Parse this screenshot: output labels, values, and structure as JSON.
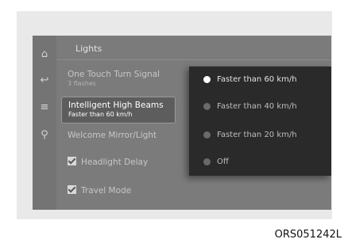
{
  "screen": {
    "title": "Lights"
  },
  "nav": [
    {
      "icon": "home-icon",
      "glyph": "⌂"
    },
    {
      "icon": "back-icon",
      "glyph": "↩"
    },
    {
      "icon": "menu-icon",
      "glyph": "≡"
    },
    {
      "icon": "search-icon",
      "glyph": "⚲"
    }
  ],
  "settings": {
    "one_touch": {
      "label": "One Touch Turn Signal",
      "value": "3 flashes"
    },
    "intelligent": {
      "label": "Intelligent High Beams",
      "value": "Faster than 60 km/h"
    },
    "welcome": {
      "label": "Welcome Mirror/Light"
    },
    "headlight": {
      "label": "Headlight Delay",
      "checked": true
    },
    "travel": {
      "label": "Travel Mode",
      "checked": true
    }
  },
  "popup": {
    "options": [
      {
        "label": "Faster than 60 km/h",
        "selected": true
      },
      {
        "label": "Faster than 40 km/h",
        "selected": false
      },
      {
        "label": "Faster than 20 km/h",
        "selected": false
      },
      {
        "label": "Off",
        "selected": false
      }
    ]
  },
  "caption": "ORS051242L"
}
